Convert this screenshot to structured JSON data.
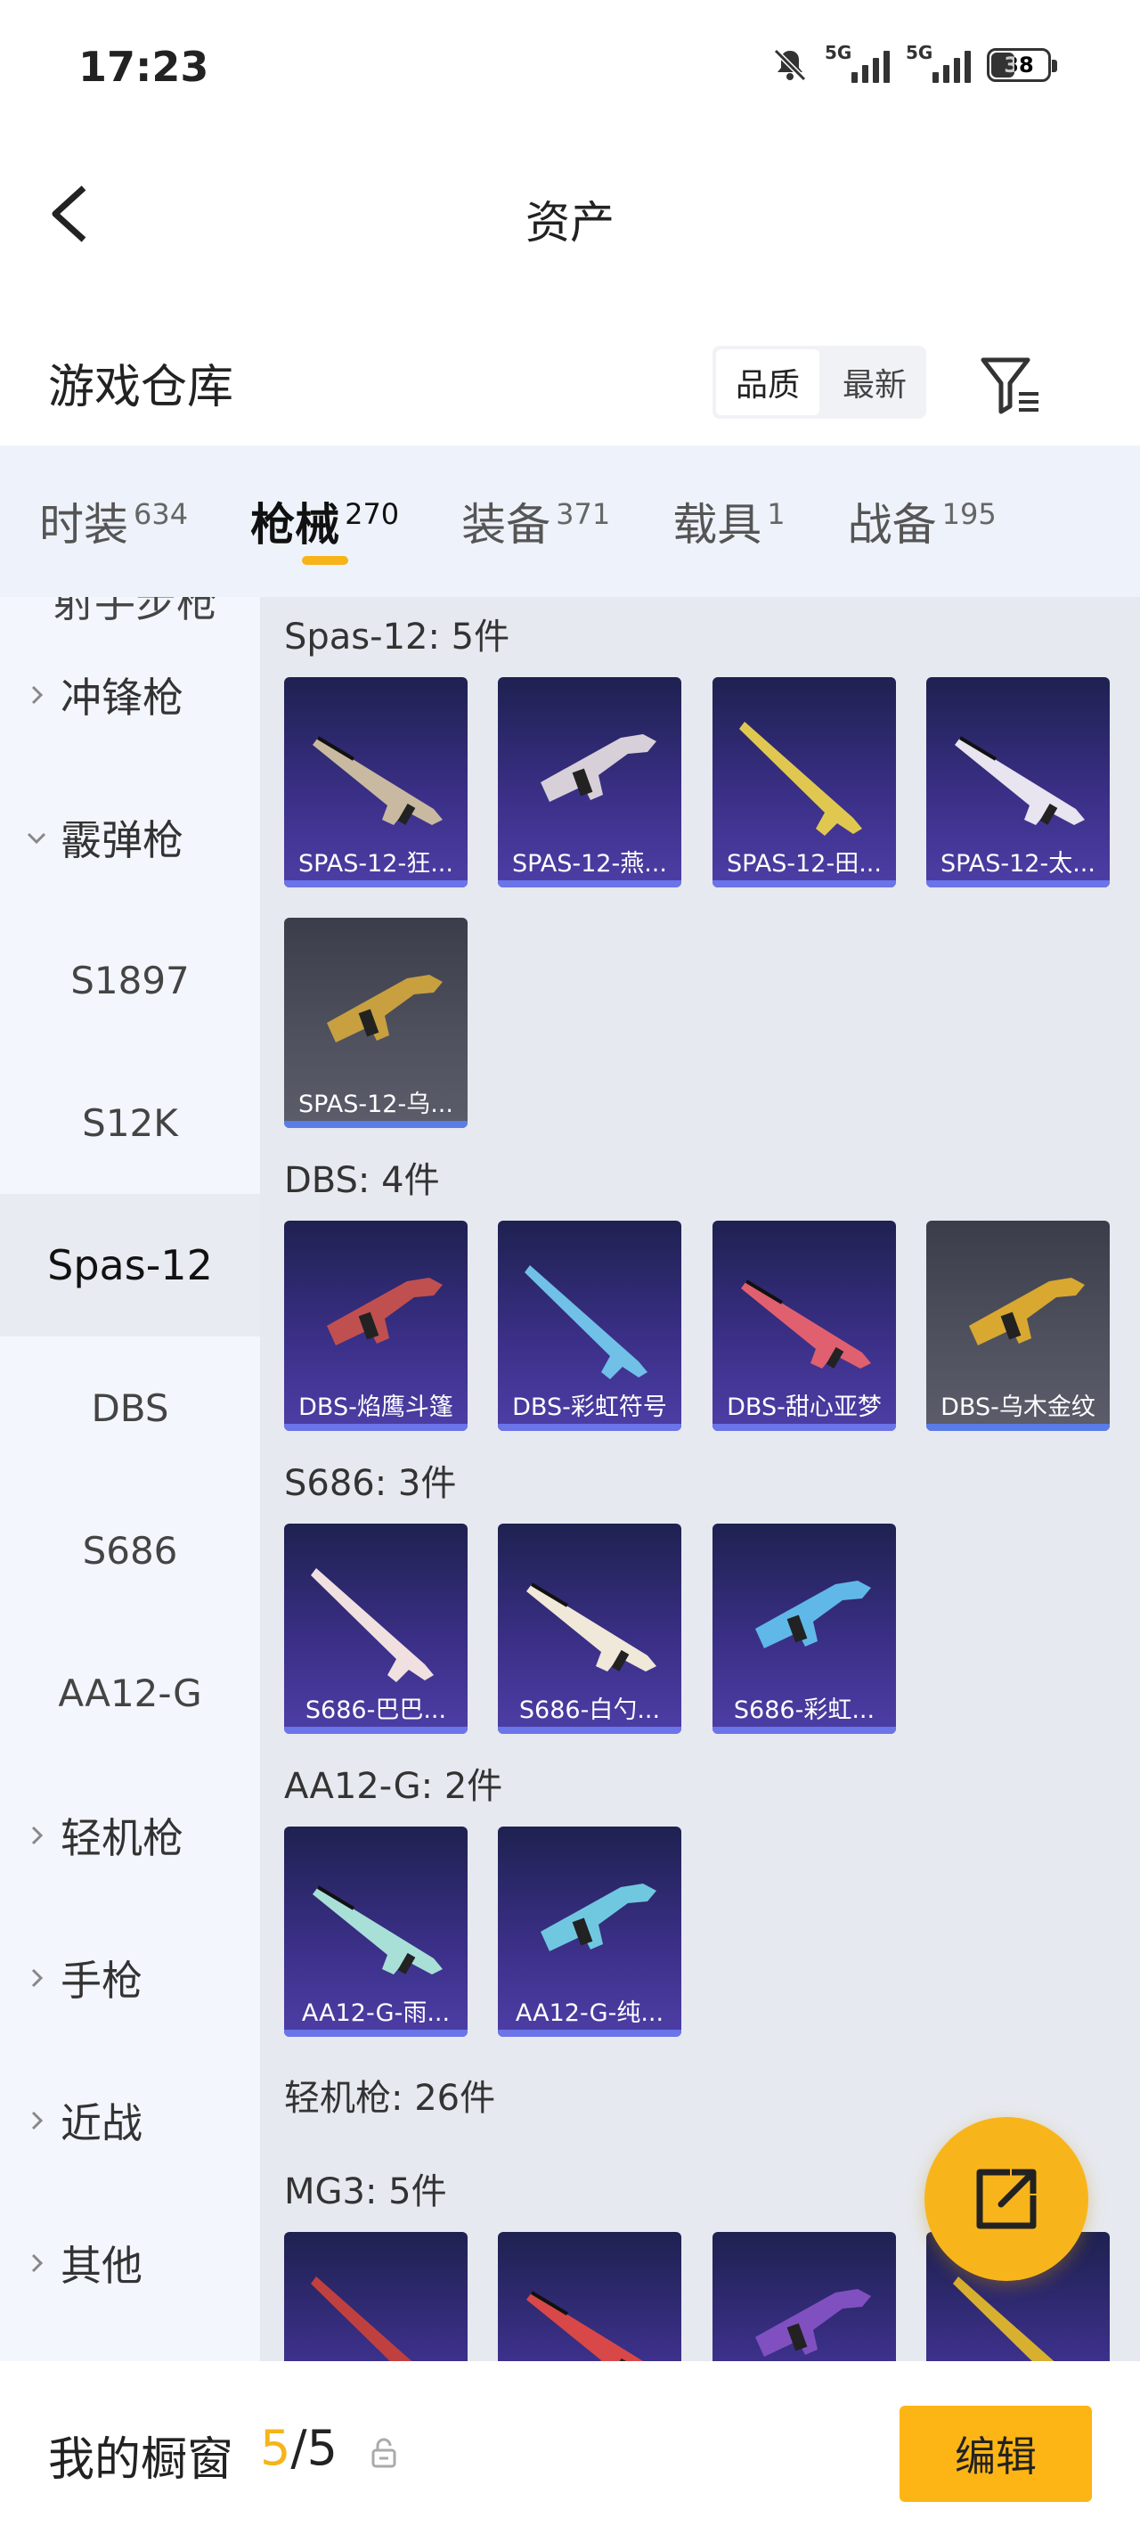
{
  "status_bar": {
    "time": "17:23",
    "network_1": "5G",
    "network_2": "5G",
    "battery": "38"
  },
  "header": {
    "title": "资产"
  },
  "warehouse": {
    "label": "游戏仓库",
    "sort_options": [
      "品质",
      "最新"
    ],
    "active_sort": "品质"
  },
  "tabs": [
    {
      "label": "时装",
      "count": "634"
    },
    {
      "label": "枪械",
      "count": "270",
      "active": true
    },
    {
      "label": "装备",
      "count": "371"
    },
    {
      "label": "载具",
      "count": "1"
    },
    {
      "label": "战备",
      "count": "195"
    }
  ],
  "sidebar": {
    "partial_label": "射手步枪",
    "items": [
      {
        "label": "冲锋枪",
        "type": "group",
        "expanded": false
      },
      {
        "label": "霰弹枪",
        "type": "group",
        "expanded": true
      },
      {
        "label": "S1897",
        "type": "sub"
      },
      {
        "label": "S12K",
        "type": "sub"
      },
      {
        "label": "Spas-12",
        "type": "sub",
        "selected": true
      },
      {
        "label": "DBS",
        "type": "sub"
      },
      {
        "label": "S686",
        "type": "sub"
      },
      {
        "label": "AA12-G",
        "type": "sub"
      },
      {
        "label": "轻机枪",
        "type": "group",
        "expanded": false
      },
      {
        "label": "手枪",
        "type": "group",
        "expanded": false
      },
      {
        "label": "近战",
        "type": "group",
        "expanded": false
      },
      {
        "label": "其他",
        "type": "group",
        "expanded": false
      }
    ]
  },
  "sections": [
    {
      "title": "Spas-12: 5件",
      "items": [
        {
          "name": "SPAS-12-狂...",
          "rarity": "purple",
          "color": "#c9b9a0"
        },
        {
          "name": "SPAS-12-燕...",
          "rarity": "purple",
          "color": "#d8d0d8"
        },
        {
          "name": "SPAS-12-田...",
          "rarity": "purple",
          "color": "#e0c850"
        },
        {
          "name": "SPAS-12-太...",
          "rarity": "purple",
          "color": "#e8e4f0"
        },
        {
          "name": "SPAS-12-乌...",
          "rarity": "gray",
          "color": "#c8a040"
        }
      ]
    },
    {
      "title": "DBS: 4件",
      "items": [
        {
          "name": "DBS-焰鹰斗篷",
          "rarity": "purple",
          "color": "#c05050"
        },
        {
          "name": "DBS-彩虹符号",
          "rarity": "purple",
          "color": "#70c0e8"
        },
        {
          "name": "DBS-甜心亚梦",
          "rarity": "purple",
          "color": "#e06070"
        },
        {
          "name": "DBS-乌木金纹",
          "rarity": "gray",
          "color": "#d8a830"
        }
      ]
    },
    {
      "title": "S686: 3件",
      "items": [
        {
          "name": "S686-巴巴...",
          "rarity": "purple",
          "color": "#f0e0e0"
        },
        {
          "name": "S686-白勺...",
          "rarity": "purple",
          "color": "#f0e8d8"
        },
        {
          "name": "S686-彩虹...",
          "rarity": "purple",
          "color": "#60b8e8"
        }
      ]
    },
    {
      "title": "AA12-G: 2件",
      "items": [
        {
          "name": "AA12-G-雨...",
          "rarity": "purple",
          "color": "#a8e0d8"
        },
        {
          "name": "AA12-G-纯...",
          "rarity": "purple",
          "color": "#70c8e0"
        }
      ]
    },
    {
      "title": "轻机枪: 26件",
      "items": []
    },
    {
      "title": "MG3: 5件",
      "items": [
        {
          "name": "",
          "rarity": "purple",
          "color": "#c04040"
        },
        {
          "name": "",
          "rarity": "purple",
          "color": "#d84848"
        },
        {
          "name": "",
          "rarity": "purple",
          "color": "#8050c0"
        },
        {
          "name": "",
          "rarity": "purple",
          "color": "#d8b030"
        }
      ]
    }
  ],
  "bottom": {
    "label": "我的橱窗",
    "current": "5",
    "separator": "/",
    "total": "5",
    "edit_label": "编辑"
  },
  "colors": {
    "accent": "#f6b41a",
    "card_purple": "#3a2f86",
    "card_gray": "#50525f"
  }
}
